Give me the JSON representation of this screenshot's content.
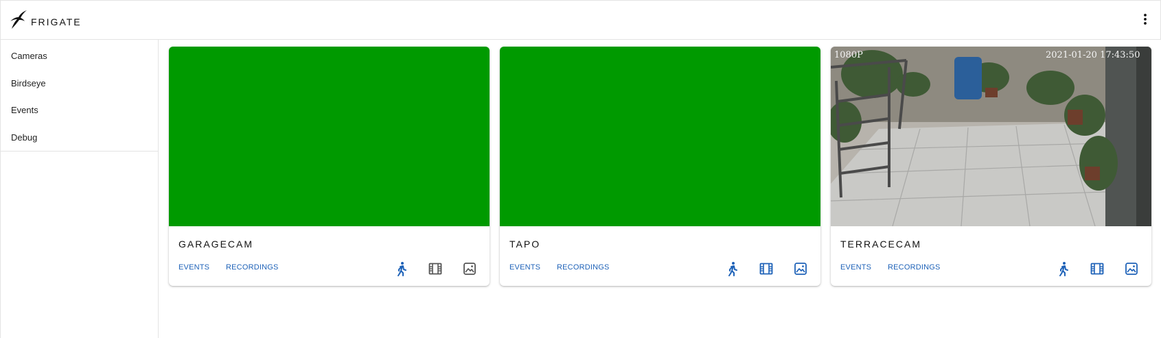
{
  "app": {
    "brand": "FRIGATE"
  },
  "sidebar": {
    "items": [
      {
        "label": "Cameras"
      },
      {
        "label": "Birdseye"
      },
      {
        "label": "Events"
      },
      {
        "label": "Debug"
      }
    ]
  },
  "cameras": [
    {
      "name": "GARAGECAM",
      "events_label": "EVENTS",
      "recordings_label": "RECORDINGS",
      "feed": "green",
      "detect_color": "#1e62b8",
      "record_color": "#555555",
      "snapshot_color": "#555555"
    },
    {
      "name": "TAPO",
      "events_label": "EVENTS",
      "recordings_label": "RECORDINGS",
      "feed": "green",
      "detect_color": "#1e62b8",
      "record_color": "#1e62b8",
      "snapshot_color": "#1e62b8"
    },
    {
      "name": "TERRACECAM",
      "events_label": "EVENTS",
      "recordings_label": "RECORDINGS",
      "feed": "image",
      "resolution_overlay": "1080P",
      "timestamp_overlay": "2021-01-20 17:43:50",
      "detect_color": "#1e62b8",
      "record_color": "#1e62b8",
      "snapshot_color": "#1e62b8"
    }
  ],
  "icons": {
    "menu": "dots-vertical-icon",
    "detect": "person-walking-icon",
    "record": "film-icon",
    "snapshot": "image-icon"
  },
  "colors": {
    "accent": "#1e62b8",
    "feed_placeholder": "#009a00"
  }
}
